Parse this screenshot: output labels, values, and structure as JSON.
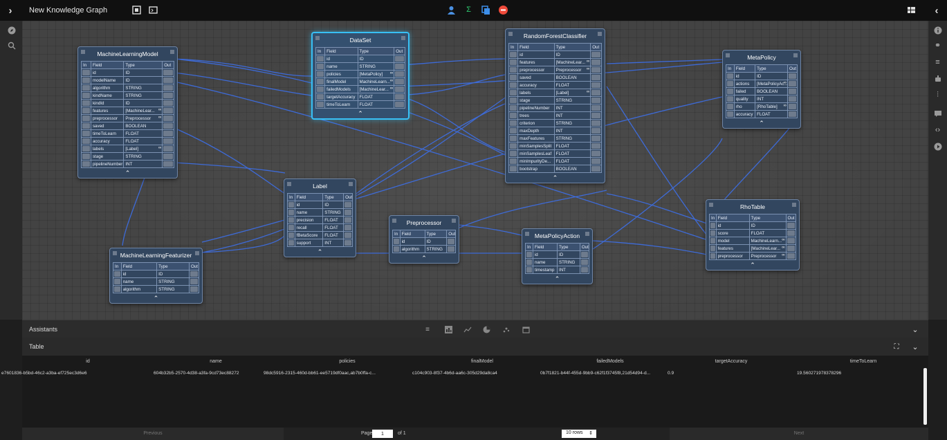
{
  "app": {
    "title": "New Knowledge Graph",
    "colors": {
      "topbar": "#101010",
      "node_bg": "#32465f",
      "selected_border": "#38c0f5",
      "edge": "#3d6fe8"
    }
  },
  "toolbar_icons": [
    "frame-icon",
    "fit-icon",
    "user-icon",
    "sum-icon",
    "copy-icon",
    "stop-icon",
    "grid-layout-icon"
  ],
  "nodes": {
    "machinelearningmodel": {
      "title": "MachineLearningModel",
      "headers": [
        "In",
        "Field",
        "Type",
        "Out"
      ],
      "rows": [
        [
          "id",
          "ID",
          ""
        ],
        [
          "modelName",
          "ID",
          ""
        ],
        [
          "algorithm",
          "STRING",
          ""
        ],
        [
          "kindName",
          "STRING",
          ""
        ],
        [
          "kindId",
          "ID",
          ""
        ],
        [
          "features",
          "[MachineLear...",
          "link"
        ],
        [
          "preprocessor",
          "Preprocessor",
          "link"
        ],
        [
          "saved",
          "BOOLEAN",
          ""
        ],
        [
          "timeToLearn",
          "FLOAT",
          ""
        ],
        [
          "accuracy",
          "FLOAT",
          ""
        ],
        [
          "labels",
          "[Label]",
          "link"
        ],
        [
          "stage",
          "STRING",
          ""
        ],
        [
          "pipelineNumber",
          "INT",
          ""
        ]
      ],
      "collapse": "⌃"
    },
    "dataset": {
      "title": "DataSet",
      "headers": [
        "In",
        "Field",
        "Type",
        "Out"
      ],
      "rows": [
        [
          "id",
          "ID",
          ""
        ],
        [
          "name",
          "STRING",
          ""
        ],
        [
          "policies",
          "[MetaPolicy]",
          "link"
        ],
        [
          "finalModel",
          "MachineLearn...",
          "link"
        ],
        [
          "failedModels",
          "[MachineLear...",
          "link"
        ],
        [
          "targetAccuracy",
          "FLOAT",
          ""
        ],
        [
          "timeToLearn",
          "FLOAT",
          ""
        ]
      ],
      "collapse": "⌃"
    },
    "randomforestclassifier": {
      "title": "RandomForestClassifier",
      "headers": [
        "In",
        "Field",
        "Type",
        "Out"
      ],
      "rows": [
        [
          "id",
          "ID",
          ""
        ],
        [
          "features",
          "[MachineLear...",
          "link"
        ],
        [
          "preprocessor",
          "Preprocessor",
          "link"
        ],
        [
          "saved",
          "BOOLEAN",
          ""
        ],
        [
          "accuracy",
          "FLOAT",
          ""
        ],
        [
          "labels",
          "[Label]",
          "link"
        ],
        [
          "stage",
          "STRING",
          ""
        ],
        [
          "pipelineNumber",
          "INT",
          ""
        ],
        [
          "trees",
          "INT",
          ""
        ],
        [
          "criterion",
          "STRING",
          ""
        ],
        [
          "maxDepth",
          "INT",
          ""
        ],
        [
          "maxFeatures",
          "STRING",
          ""
        ],
        [
          "minSamplesSplit",
          "FLOAT",
          ""
        ],
        [
          "minSamplesLeaf",
          "FLOAT",
          ""
        ],
        [
          "minImpurityDe...",
          "FLOAT",
          ""
        ],
        [
          "bootstrap",
          "BOOLEAN",
          ""
        ]
      ],
      "collapse": "⌃"
    },
    "metapolicy": {
      "title": "MetaPolicy",
      "headers": [
        "In",
        "Field",
        "Type",
        "Out"
      ],
      "rows": [
        [
          "id",
          "ID",
          ""
        ],
        [
          "actions",
          "[MetaPolicyAc...",
          "link"
        ],
        [
          "failed",
          "BOOLEAN",
          ""
        ],
        [
          "quality",
          "INT",
          ""
        ],
        [
          "rho",
          "[RhoTable]",
          "link"
        ],
        [
          "accuracy",
          "FLOAT",
          ""
        ]
      ],
      "collapse": "⌃"
    },
    "label": {
      "title": "Label",
      "headers": [
        "In",
        "Field",
        "Type",
        "Out"
      ],
      "rows": [
        [
          "id",
          "ID",
          ""
        ],
        [
          "name",
          "STRING",
          ""
        ],
        [
          "precision",
          "FLOAT",
          ""
        ],
        [
          "recall",
          "FLOAT",
          ""
        ],
        [
          "fBetaScore",
          "FLOAT",
          ""
        ],
        [
          "support",
          "INT",
          ""
        ]
      ],
      "collapse": "⌃"
    },
    "preprocessor": {
      "title": "Preprocessor",
      "headers": [
        "In",
        "Field",
        "Type",
        "Out"
      ],
      "rows": [
        [
          "id",
          "ID",
          ""
        ],
        [
          "algorithm",
          "STRING",
          ""
        ]
      ],
      "collapse": "⌃"
    },
    "metapolicyaction": {
      "title": "MetaPolicyAction",
      "headers": [
        "In",
        "Field",
        "Type",
        "Out"
      ],
      "rows": [
        [
          "id",
          "ID",
          ""
        ],
        [
          "name",
          "STRING",
          ""
        ],
        [
          "timestamp",
          "INT",
          ""
        ]
      ],
      "collapse": "⌃"
    },
    "rhotable": {
      "title": "RhoTable",
      "headers": [
        "In",
        "Field",
        "Type",
        "Out"
      ],
      "rows": [
        [
          "id",
          "ID",
          ""
        ],
        [
          "score",
          "FLOAT",
          ""
        ],
        [
          "model",
          "MachineLearn...",
          "link"
        ],
        [
          "features",
          "[MachineLear...",
          "link"
        ],
        [
          "preprocessor",
          "Preprocessor",
          "link"
        ]
      ],
      "collapse": "⌃"
    },
    "machinelearningfeaturizer": {
      "title": "MachineLearningFeaturizer",
      "headers": [
        "In",
        "Field",
        "Type",
        "Out"
      ],
      "rows": [
        [
          "id",
          "ID",
          ""
        ],
        [
          "name",
          "STRING",
          ""
        ],
        [
          "algorithm",
          "STRING",
          ""
        ]
      ],
      "collapse": "⌃"
    }
  },
  "assistants": {
    "label": "Assistants",
    "icons": [
      "list-icon",
      "bar-chart-icon",
      "line-chart-icon",
      "pie-chart-icon",
      "scatter-icon",
      "window-icon"
    ],
    "collapse": "⌄"
  },
  "table": {
    "label": "Table",
    "columns": [
      "id",
      "name",
      "policies",
      "finalModel",
      "failedModels",
      "targetAccuracy",
      "timeToLearn"
    ],
    "row": [
      "e7601836-b5bd-46c2-a3ba-ef725ec3d6e6",
      "604b32b5-2570-4d38-a3fa-9cd73ec88272",
      "98dc5916-2315-460d-bb61-ee5719df0aac,ab7b0ffa-c...",
      "c104c903-8f37-4b6d-aa6c-305d29da8ca4",
      "0b7f1821-b44f-455d-9bb9-c62f1f3745f8,21d54d94-d...",
      "0.9",
      "19.560271978378296"
    ],
    "previous": "Previous",
    "next": "Next",
    "page_label": "Page",
    "page_value": "1",
    "of_label": "of 1",
    "rows_option": "10 rows"
  }
}
